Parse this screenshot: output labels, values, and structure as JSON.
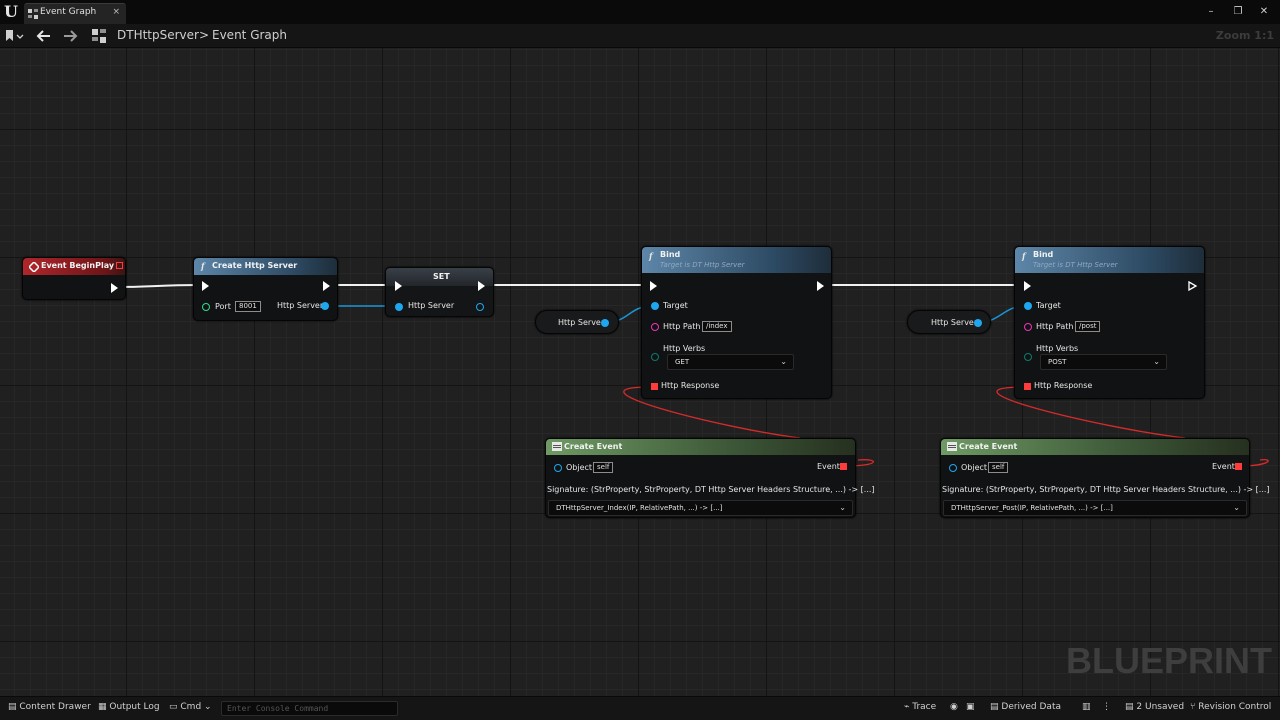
{
  "window": {
    "tab_title": "Event Graph",
    "tab_close": "×",
    "minimize": "–",
    "maximize": "❐",
    "close": "✕"
  },
  "toolbar": {
    "breadcrumb_blueprint": "DTHttpServer",
    "breadcrumb_separator": ">",
    "breadcrumb_graph": "Event Graph",
    "zoom": "Zoom 1:1"
  },
  "graph": {
    "watermark": "BLUEPRINT",
    "nodes": {
      "begin_play": {
        "title": "Event BeginPlay"
      },
      "create_server": {
        "title": "Create Http Server",
        "port_label": "Port",
        "port_value": "8001",
        "output_label": "Http Server"
      },
      "set": {
        "title": "SET",
        "input_label": "Http Server"
      },
      "get_var_1": {
        "label": "Http Server"
      },
      "get_var_2": {
        "label": "Http Server"
      },
      "bind_1": {
        "title": "Bind",
        "subtitle": "Target is DT Http Server",
        "target_label": "Target",
        "path_label": "Http Path",
        "path_value": "/index",
        "verbs_label": "Http Verbs",
        "verb_value": "GET",
        "response_label": "Http Response"
      },
      "bind_2": {
        "title": "Bind",
        "subtitle": "Target is DT Http Server",
        "target_label": "Target",
        "path_label": "Http Path",
        "path_value": "/post",
        "verbs_label": "Http Verbs",
        "verb_value": "POST",
        "response_label": "Http Response"
      },
      "create_event_1": {
        "title": "Create Event",
        "object_label": "Object",
        "object_value": "self",
        "event_label": "Event",
        "signature": "Signature: (StrProperty, StrProperty, DT Http Server Headers Structure, ...) -> [...]",
        "function": "DTHttpServer_Index(IP, RelativePath, ...) -> [...]"
      },
      "create_event_2": {
        "title": "Create Event",
        "object_label": "Object",
        "object_value": "self",
        "event_label": "Event",
        "signature": "Signature: (StrProperty, StrProperty, DT Http Server Headers Structure, ...) -> [...]",
        "function": "DTHttpServer_Post(IP, RelativePath, ...) -> [...]"
      }
    }
  },
  "colors": {
    "event_header": "#a11e22",
    "function_header": "#4f7390",
    "create_event_header": "#506e49",
    "object_pin": "#1ea7f0",
    "string_pin": "#f034b4",
    "enum_pin": "#0d7a70",
    "delegate_pin": "#ff3b3b",
    "exec_wire": "#ffffff",
    "object_wire": "#1a95d6",
    "delegate_wire": "#d52b2b"
  },
  "statusbar": {
    "content_drawer": "Content Drawer",
    "output_log": "Output Log",
    "cmd": "Cmd",
    "console_placeholder": "Enter Console Command",
    "trace": "Trace",
    "derived_data": "Derived Data",
    "unsaved": "2 Unsaved",
    "revision_control": "Revision Control"
  }
}
